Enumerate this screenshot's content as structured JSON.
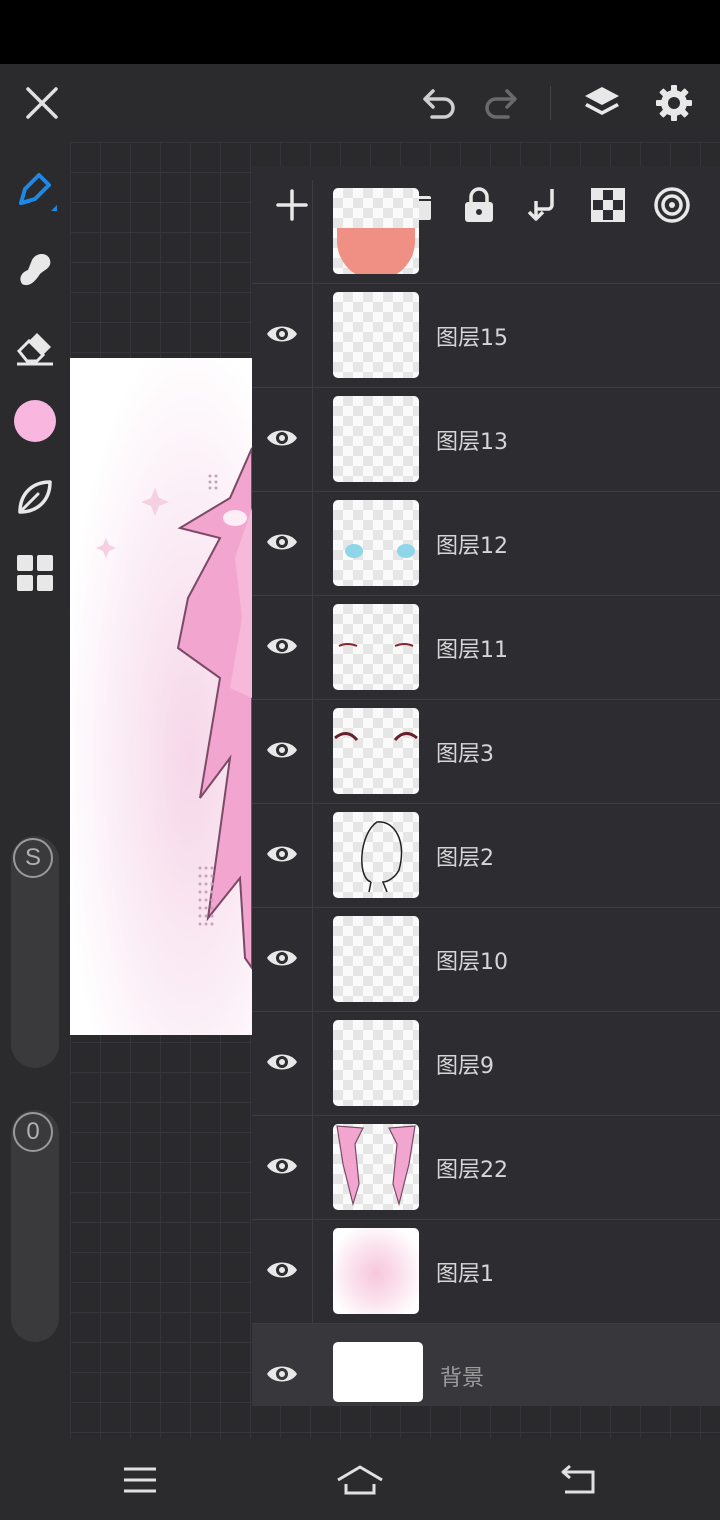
{
  "top_bar": {
    "icons": [
      "close-icon",
      "undo-icon",
      "redo-icon",
      "layers-icon",
      "settings-icon"
    ]
  },
  "left_toolbar": {
    "tools": [
      "pen-icon",
      "smudge-icon",
      "eraser-icon",
      "color-swatch",
      "leaf-icon",
      "grid-icon"
    ],
    "brush_color": "#f9b6de",
    "accent_color": "#1e88e5",
    "size_label": "S",
    "opacity_label": "0"
  },
  "layers_panel": {
    "toolbar_icons": [
      "add-icon",
      "folder-icon",
      "lock-icon",
      "merge-down-icon",
      "checker-icon",
      "target-icon"
    ],
    "layers": [
      {
        "name": "图层15",
        "visible": true
      },
      {
        "name": "图层13",
        "visible": true
      },
      {
        "name": "图层12",
        "visible": true
      },
      {
        "name": "图层11",
        "visible": true
      },
      {
        "name": "图层3",
        "visible": true
      },
      {
        "name": "图层2",
        "visible": true
      },
      {
        "name": "图层10",
        "visible": true
      },
      {
        "name": "图层9",
        "visible": true
      },
      {
        "name": "图层22",
        "visible": true
      },
      {
        "name": "图层1",
        "visible": true
      },
      {
        "name": "背景",
        "visible": true
      }
    ]
  },
  "nav_bar": {
    "icons": [
      "menu-icon",
      "home-icon",
      "back-icon"
    ]
  }
}
